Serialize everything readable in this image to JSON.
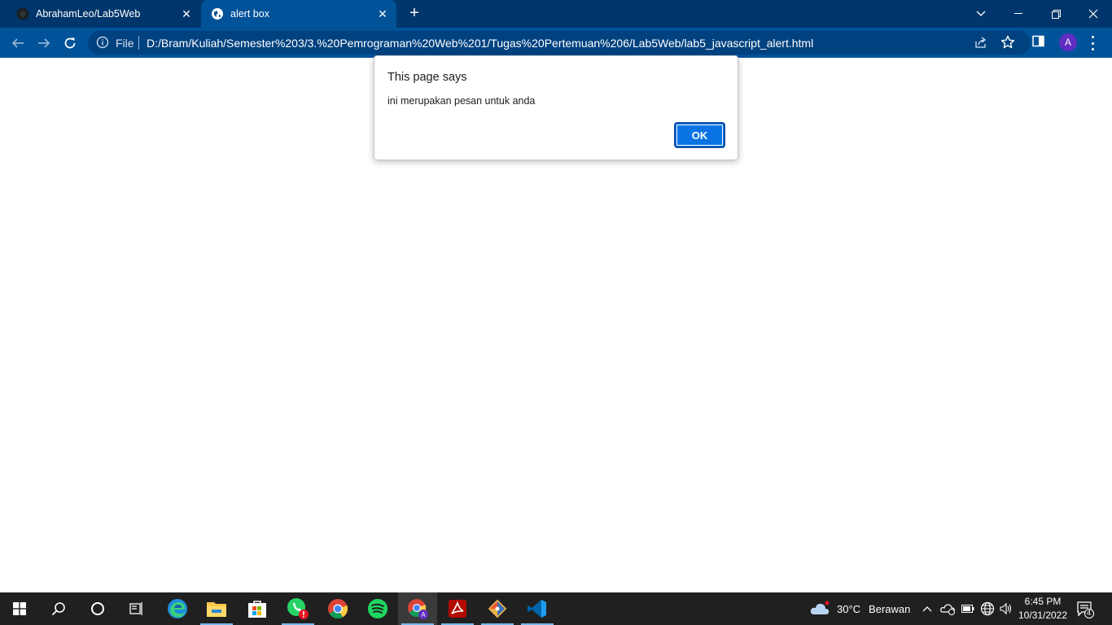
{
  "browser": {
    "tabs": [
      {
        "title": "AbrahamLeo/Lab5Web",
        "active": false,
        "icon": "github-icon"
      },
      {
        "title": "alert box",
        "active": true,
        "icon": "globe-icon"
      }
    ],
    "omnibox": {
      "scheme_label": "File",
      "url": "D:/Bram/Kuliah/Semester%203/3.%20Pemrograman%20Web%201/Tugas%20Pertemuan%206/Lab5Web/lab5_javascript_alert.html"
    },
    "profile_initial": "A",
    "colors": {
      "tabbar": "#00366b",
      "toolbar": "#005299"
    }
  },
  "dialog": {
    "title": "This page says",
    "message": "ini merupakan pesan untuk anda",
    "ok_label": "OK",
    "button_color": "#0b74e5"
  },
  "taskbar": {
    "apps": [
      "start-icon",
      "search-icon",
      "cortana-icon",
      "task-view-icon",
      "edge-icon",
      "file-explorer-icon",
      "microsoft-store-icon",
      "whatsapp-icon",
      "chrome-icon",
      "spotify-icon",
      "chrome-profile-icon",
      "acrobat-icon",
      "git-icon",
      "vscode-icon"
    ],
    "weather": {
      "temp": "30°C",
      "condition": "Berawan"
    },
    "clock": {
      "time": "6:45 PM",
      "date": "10/31/2022"
    },
    "notification_count": "4"
  }
}
